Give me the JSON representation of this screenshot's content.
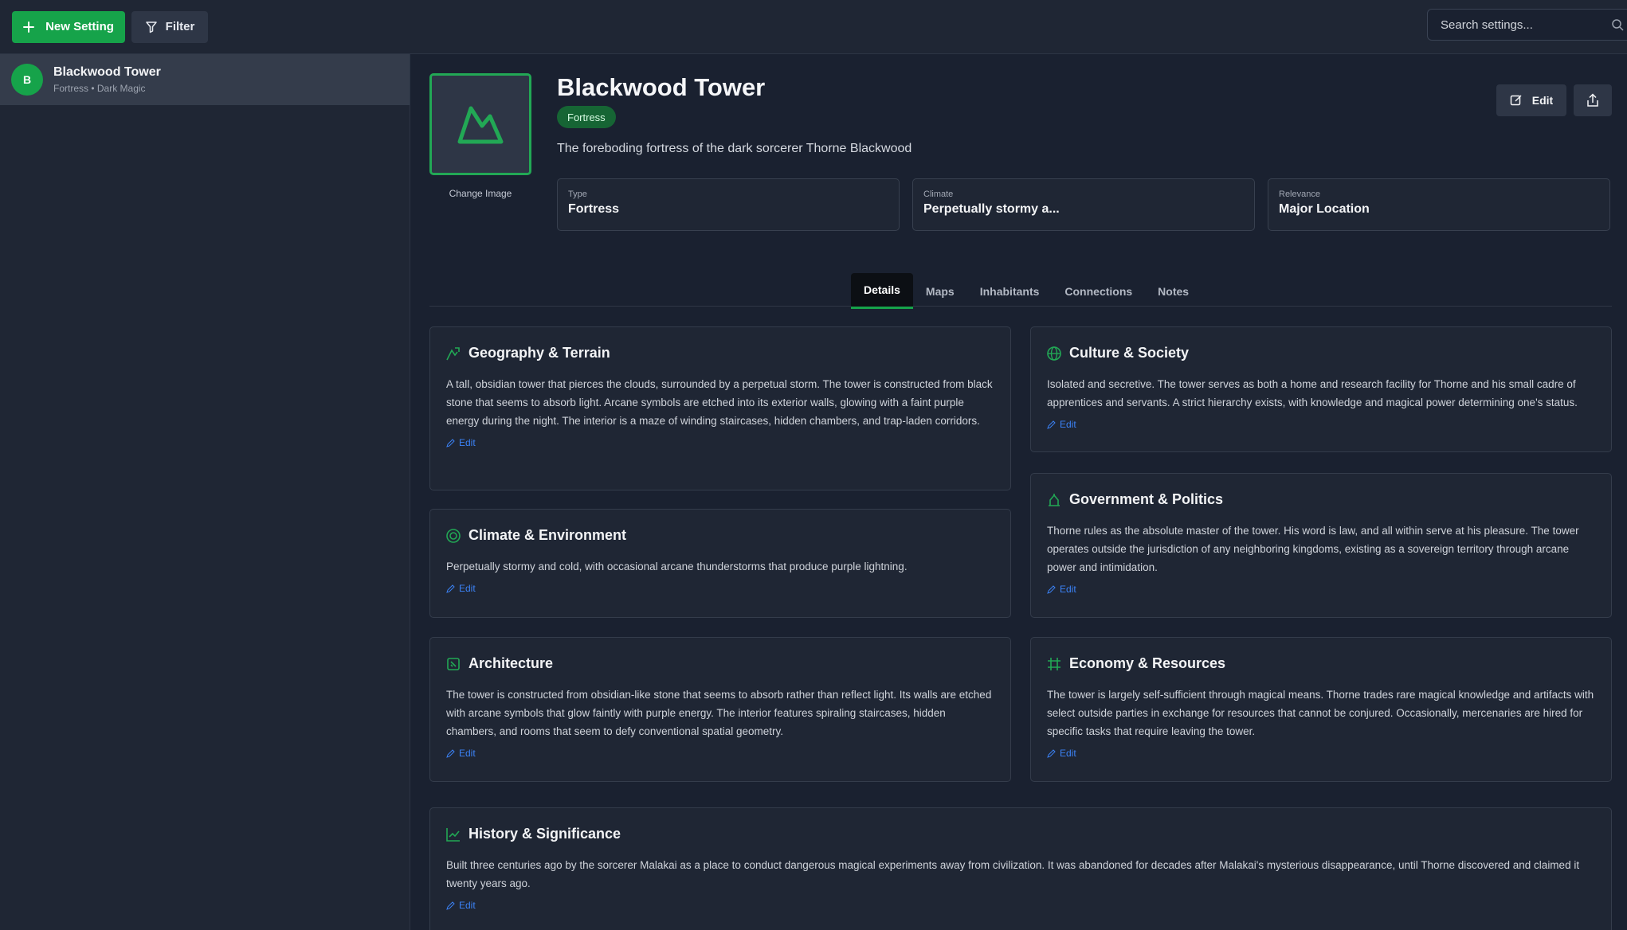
{
  "toolbar": {
    "new_label": "New Setting",
    "filter_label": "Filter",
    "search_placeholder": "Search settings..."
  },
  "sidebar": {
    "items": [
      {
        "avatar": "B",
        "title": "Blackwood Tower",
        "subtitle": "Fortress • Dark Magic"
      }
    ]
  },
  "detail": {
    "title": "Blackwood Tower",
    "badge": "Fortress",
    "description": "The foreboding fortress of the dark sorcerer Thorne Blackwood",
    "change_image": "Change Image",
    "edit_label": "Edit",
    "stats": [
      {
        "label": "Type",
        "value": "Fortress"
      },
      {
        "label": "Climate",
        "value": "Perpetually stormy a..."
      },
      {
        "label": "Relevance",
        "value": "Major Location"
      }
    ],
    "tabs": [
      "Details",
      "Maps",
      "Inhabitants",
      "Connections",
      "Notes"
    ],
    "active_tab": "Details"
  },
  "sections": {
    "geography": {
      "title": "Geography & Terrain",
      "body": "A tall, obsidian tower that pierces the clouds, surrounded by a perpetual storm. The tower is constructed from black stone that seems to absorb light. Arcane symbols are etched into its exterior walls, glowing with a faint purple energy during the night. The interior is a maze of winding staircases, hidden chambers, and trap-laden corridors.",
      "icon": "mountain-icon"
    },
    "culture": {
      "title": "Culture & Society",
      "body": "Isolated and secretive. The tower serves as both a home and research facility for Thorne and his small cadre of apprentices and servants. A strict hierarchy exists, with knowledge and magical power determining one's status.",
      "icon": "globe-icon"
    },
    "climate": {
      "title": "Climate & Environment",
      "body": "Perpetually stormy and cold, with occasional arcane thunderstorms that produce purple lightning.",
      "icon": "target-icon"
    },
    "government": {
      "title": "Government & Politics",
      "body": "Thorne rules as the absolute master of the tower. His word is law, and all within serve at his pleasure. The tower operates outside the jurisdiction of any neighboring kingdoms, existing as a sovereign territory through arcane power and intimidation.",
      "icon": "landmark-icon"
    },
    "architecture": {
      "title": "Architecture",
      "body": "The tower is constructed from obsidian-like stone that seems to absorb rather than reflect light. Its walls are etched with arcane symbols that glow faintly with purple energy. The interior features spiraling staircases, hidden chambers, and rooms that seem to defy conventional spatial geometry.",
      "icon": "building-icon"
    },
    "economy": {
      "title": "Economy & Resources",
      "body": "The tower is largely self-sufficient through magical means. Thorne trades rare magical knowledge and artifacts with select outside parties in exchange for resources that cannot be conjured. Occasionally, mercenaries are hired for specific tasks that require leaving the tower.",
      "icon": "grid-icon"
    },
    "history": {
      "title": "History & Significance",
      "body": "Built three centuries ago by the sorcerer Malakai as a place to conduct dangerous magical experiments away from civilization. It was abandoned for decades after Malakai's mysterious disappearance, until Thorne discovered and claimed it twenty years ago.",
      "icon": "chart-icon"
    },
    "edit_label": "Edit"
  },
  "colors": {
    "accent": "#16a34a",
    "link": "#3b82f6",
    "background": "#1a2130",
    "panel": "#1f2634"
  }
}
